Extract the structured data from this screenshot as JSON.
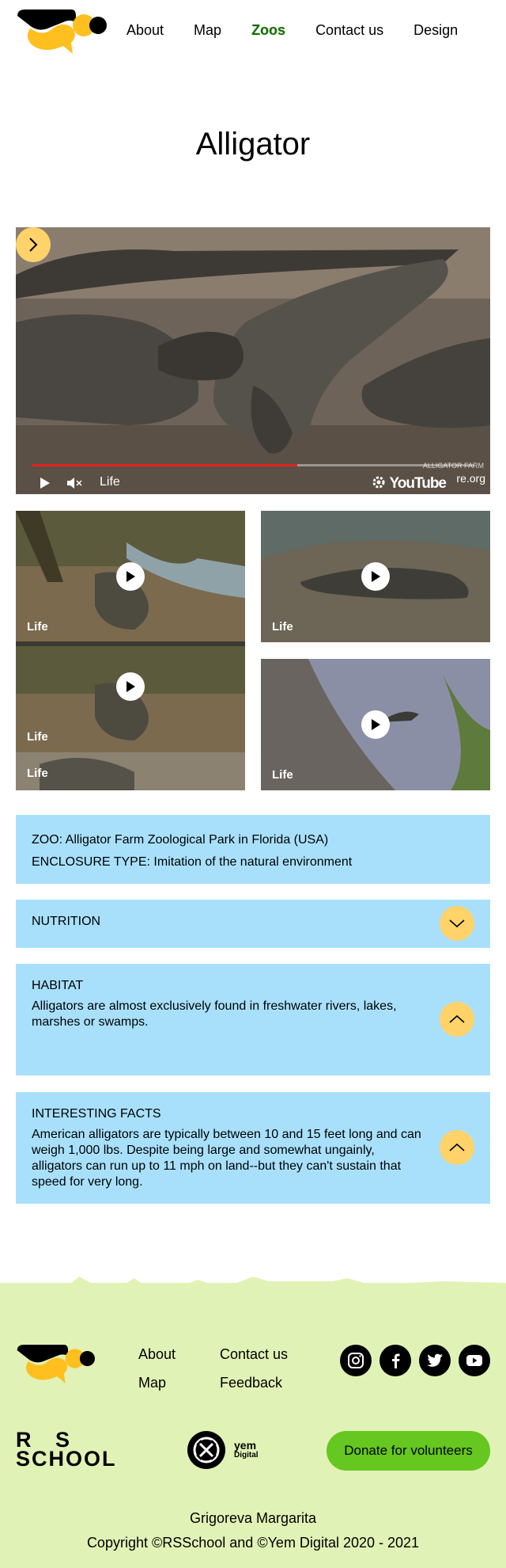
{
  "nav": {
    "items": [
      {
        "label": "About",
        "active": false
      },
      {
        "label": "Map",
        "active": false
      },
      {
        "label": "Zoos",
        "active": true
      },
      {
        "label": "Contact us",
        "active": false
      },
      {
        "label": "Design",
        "active": false
      }
    ]
  },
  "page": {
    "title": "Alligator"
  },
  "colors": {
    "accent_yellow": "#ffd369",
    "info_blue": "#a8e0fc",
    "footer_green": "#e1f2b6",
    "donate_green": "#65c71f",
    "nav_active": "#1c6b14",
    "progress_red": "#e02020"
  },
  "video": {
    "main_label": "Life",
    "youtube_label": "YouTube",
    "site_label": "re.org",
    "watermark": "ALLIGATOR FARM",
    "progress_fraction": 0.6,
    "icons": [
      "chevron-right-icon",
      "play-icon",
      "mute-icon",
      "gear-icon",
      "fullscreen-icon"
    ]
  },
  "thumbs": [
    {
      "label": "Life"
    },
    {
      "label": "Life"
    },
    {
      "label": "Life"
    },
    {
      "label": "Life"
    },
    {
      "label": "Life"
    }
  ],
  "info": {
    "zoo": "ZOO: Alligator Farm Zoological Park in Florida (USA)",
    "enclosure": "ENCLOSURE TYPE: Imitation of the natural environment"
  },
  "accordions": [
    {
      "title": "NUTRITION",
      "text": "",
      "state": "collapsed",
      "icon": "chevron-down-icon"
    },
    {
      "title": "HABITAT",
      "text": "Alligators are almost exclusively found in freshwater rivers, lakes, marshes or swamps.",
      "state": "expanded",
      "icon": "chevron-up-icon"
    },
    {
      "title": "INTERESTING FACTS",
      "text": "American alligators are typically between 10 and 15 feet long and can weigh 1,000 lbs.  Despite being large and somewhat ungainly, alligators can run up to 11 mph on land--but they can't sustain that speed for very long.",
      "state": "expanded",
      "icon": "chevron-up-icon"
    }
  ],
  "footer": {
    "links": [
      {
        "label": "About"
      },
      {
        "label": "Map"
      },
      {
        "label": "Contact us"
      },
      {
        "label": "Feedback"
      }
    ],
    "social": [
      "instagram-icon",
      "facebook-icon",
      "twitter-icon",
      "youtube-icon"
    ],
    "rs_line1": "R   S",
    "rs_line2": "SCHOOL",
    "yem_line1": "yem",
    "yem_line2": "Digital",
    "donate_label": "Donate for volunteers",
    "author": "Grigoreva Margarita",
    "copyright": "Copyright ©RSSchool and ©Yem Digital 2020 - 2021"
  }
}
